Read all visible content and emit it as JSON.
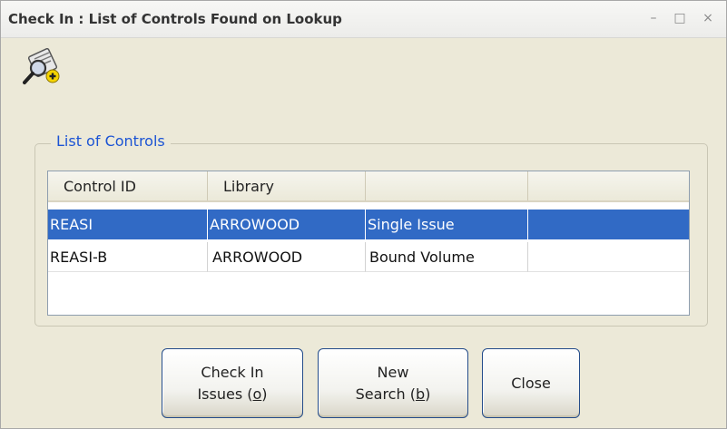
{
  "window": {
    "title": "Check In : List of Controls Found on Lookup",
    "minimize_glyph": "–",
    "maximize_glyph": "□",
    "close_glyph": "×"
  },
  "toolbar": {
    "icon": "lookup-add-icon"
  },
  "group": {
    "legend": "List of Controls"
  },
  "grid": {
    "columns": [
      "Control ID",
      "Library",
      "",
      ""
    ],
    "rows": [
      {
        "selected": true,
        "cells": [
          "REASI",
          "ARROWOOD",
          "Single Issue",
          ""
        ]
      },
      {
        "selected": false,
        "cells": [
          "REASI-B",
          "ARROWOOD",
          "Bound Volume",
          ""
        ]
      }
    ]
  },
  "buttons": {
    "check_in": {
      "line1": "Check In",
      "line2_pre": "Issues (",
      "mnemonic": "o",
      "line2_post": ")"
    },
    "new_search": {
      "line1": "New",
      "line2_pre": "Search (",
      "mnemonic": "b",
      "line2_post": ")"
    },
    "close": {
      "label": "Close"
    }
  },
  "colors": {
    "accent": "#1c54d4",
    "selection": "#316ac5",
    "background": "#ece9d8"
  }
}
